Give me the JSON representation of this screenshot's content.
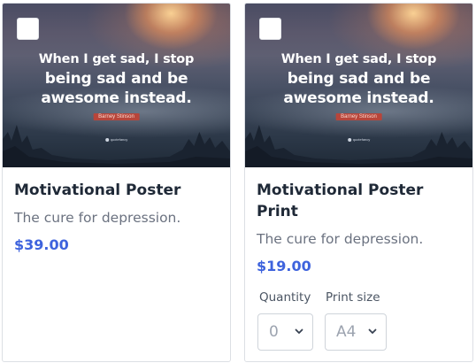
{
  "products": [
    {
      "image_quote_line1": "When I get sad, I stop",
      "image_quote_line2": "being sad and be",
      "image_quote_line3": "awesome instead.",
      "image_attribution": "Barney Stinson",
      "image_watermark": "quotefancy",
      "title": "Motivational Poster",
      "description": "The cure for depression.",
      "price": "$39.00"
    },
    {
      "image_quote_line1": "When I get sad, I stop",
      "image_quote_line2": "being sad and be",
      "image_quote_line3": "awesome instead.",
      "image_attribution": "Barney Stinson",
      "image_watermark": "quotefancy",
      "title": "Motivational Poster Print",
      "description": "The cure for depression.",
      "price": "$19.00",
      "options": {
        "quantity_label": "Quantity",
        "quantity_value": "0",
        "print_size_label": "Print size",
        "print_size_value": "A4"
      }
    }
  ],
  "icons": {
    "checkbox": "checkbox-icon",
    "chevron": "chevron-down-icon"
  },
  "colors": {
    "price": "#3e63dd",
    "tag": "#b8453a"
  }
}
